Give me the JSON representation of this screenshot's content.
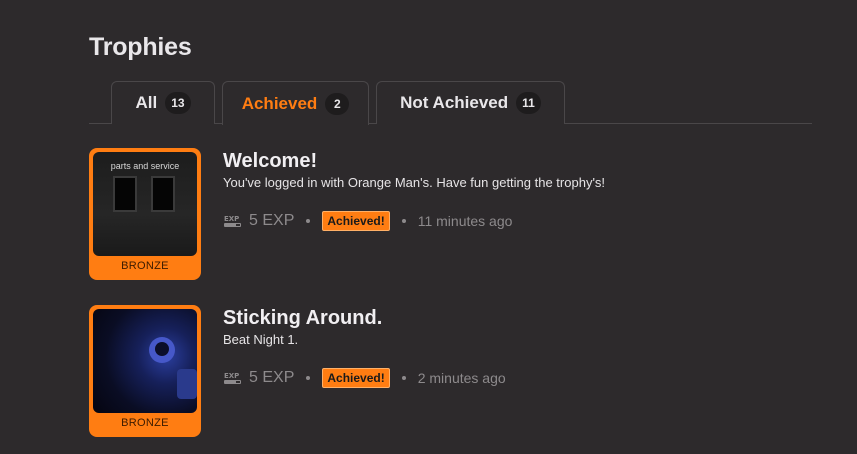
{
  "page": {
    "title": "Trophies"
  },
  "tabs": [
    {
      "label": "All",
      "count": "13"
    },
    {
      "label": "Achieved",
      "count": "2"
    },
    {
      "label": "Not Achieved",
      "count": "11"
    }
  ],
  "trophies": [
    {
      "image_caption": "parts and service",
      "tier": "BRONZE",
      "title": "Welcome!",
      "description": "You've logged in with Orange Man's. Have fun getting the trophy's!",
      "exp": "5 EXP",
      "status": "Achieved!",
      "time": "11 minutes ago"
    },
    {
      "tier": "BRONZE",
      "title": "Sticking Around.",
      "description": "Beat Night 1.",
      "exp": "5 EXP",
      "status": "Achieved!",
      "time": "2 minutes ago"
    }
  ],
  "colors": {
    "accent": "#ff7d12",
    "background": "#2d2a2c"
  }
}
